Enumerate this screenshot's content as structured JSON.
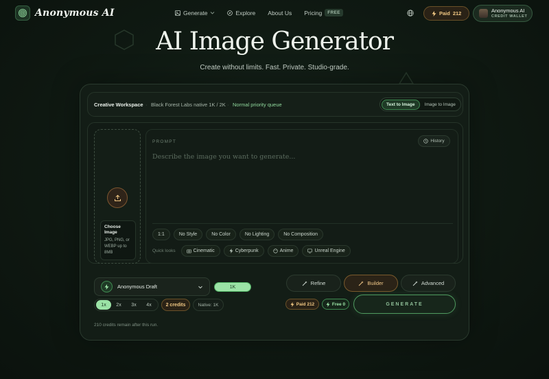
{
  "nav": {
    "brand": "Anonymous AI",
    "links": [
      {
        "label": "Generate",
        "icon": "image-icon",
        "dropdown": true
      },
      {
        "label": "Explore",
        "icon": "compass-icon"
      },
      {
        "label": "About Us"
      },
      {
        "label": "Pricing",
        "badge": "FREE"
      }
    ],
    "paid_label": "Paid",
    "paid_count": "212",
    "user_name": "Anonymous AI",
    "user_sub": "CREDIT WALLET"
  },
  "hero": {
    "title": "AI Image Generator",
    "subtitle": "Create without limits. Fast. Private. Studio-grade."
  },
  "topbar": {
    "title": "Creative Workspace",
    "model_info": "Black Forest Labs native 1K / 2K",
    "queue": "Normal priority queue",
    "modes": [
      "Text to Image",
      "Image to Image"
    ],
    "active_mode": "Text to Image"
  },
  "upload": {
    "title": "Choose Image",
    "desc": "JPG, PNG, or WEBP up to 8MB"
  },
  "prompt": {
    "label": "PROMPT",
    "history": "History",
    "placeholder": "Describe the image you want to generate..."
  },
  "chips": [
    "1:1",
    "No Style",
    "No Color",
    "No Lighting",
    "No Composition"
  ],
  "quick_looks": {
    "label": "Quick looks",
    "items": [
      "Cinematic",
      "Cyberpunk",
      "Anime",
      "Unreal Engine"
    ]
  },
  "controls": {
    "model": "Anonymous Draft",
    "resolution": "1K",
    "scales": [
      "1x",
      "2x",
      "3x",
      "4x"
    ],
    "active_scale": "1x",
    "credits": "2 credits",
    "native": "Native: 1K",
    "remaining": "210 credits remain after this run."
  },
  "tools": {
    "refine": "Refine",
    "builder": "Builder",
    "advanced": "Advanced"
  },
  "wallet": {
    "paid": "Paid 212",
    "free": "Free 0"
  },
  "generate_label": "GENERATE",
  "colors": {
    "accent_green": "#9be3a6",
    "accent_gold": "#f0c783",
    "background": "#0f1912"
  }
}
